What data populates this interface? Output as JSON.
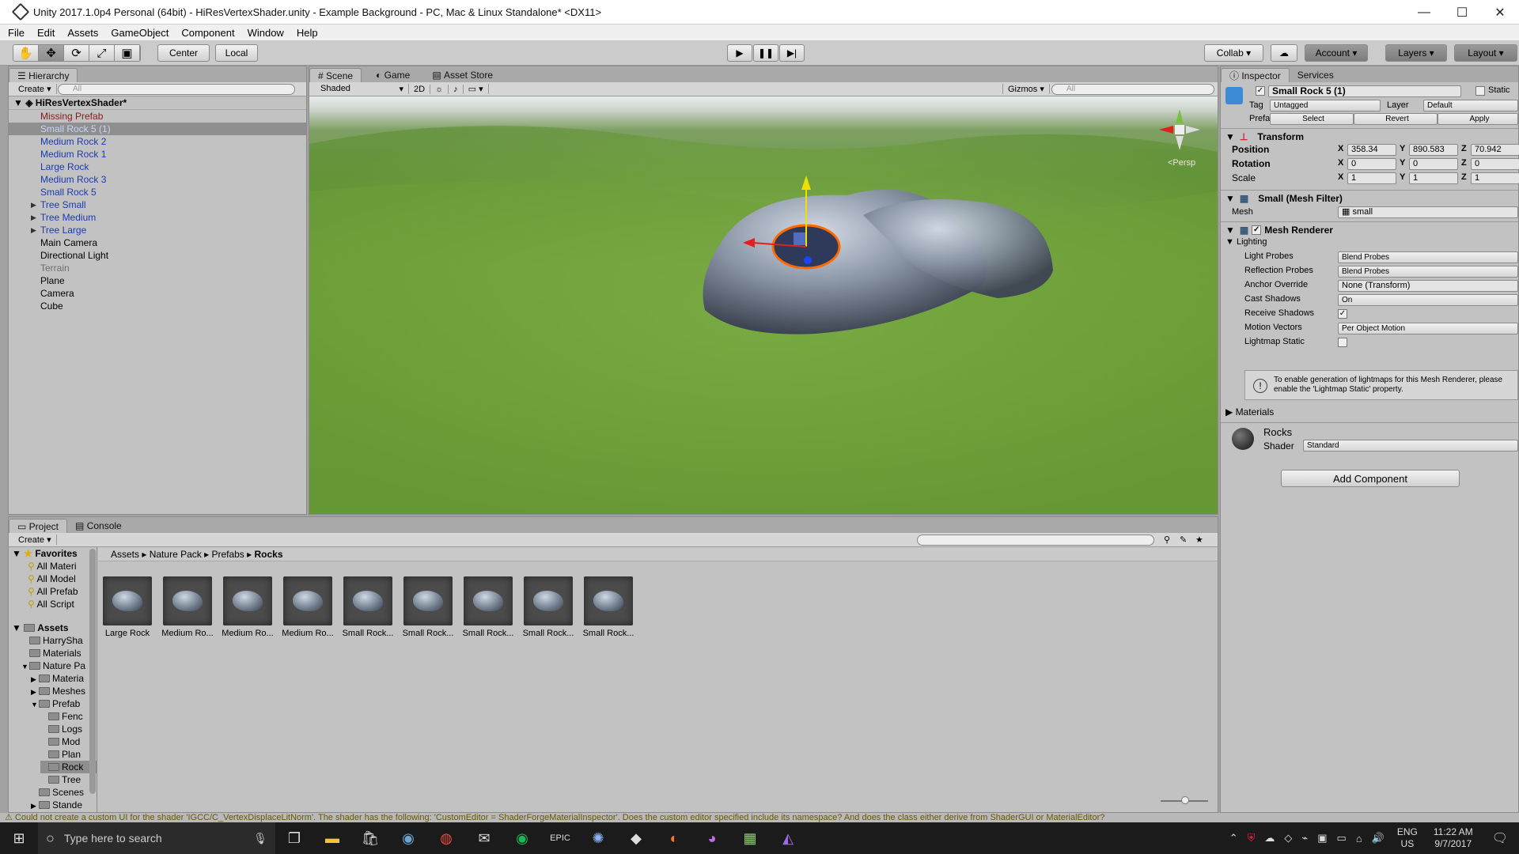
{
  "window": {
    "title": "Unity 2017.1.0p4 Personal (64bit) - HiResVertexShader.unity - Example Background - PC, Mac & Linux Standalone* <DX11>",
    "minimize": "—",
    "maximize": "☐",
    "close": "✕"
  },
  "menu": [
    "File",
    "Edit",
    "Assets",
    "GameObject",
    "Component",
    "Window",
    "Help"
  ],
  "toolbar": {
    "pivot": "Center",
    "space": "Local",
    "collab": "Collab ▾",
    "account": "Account",
    "layers": "Layers",
    "layout": "Layout"
  },
  "hierarchy": {
    "tab": "Hierarchy",
    "create": "Create",
    "search_placeholder": "All",
    "scene_name": "HiResVertexShader*",
    "items": [
      {
        "label": "Missing Prefab",
        "type": "missing",
        "arrow": ""
      },
      {
        "label": "Small Rock 5 (1)",
        "type": "sel",
        "arrow": ""
      },
      {
        "label": "Medium Rock 2",
        "type": "prefab",
        "arrow": ""
      },
      {
        "label": "Medium Rock 1",
        "type": "prefab",
        "arrow": ""
      },
      {
        "label": "Large Rock",
        "type": "prefab",
        "arrow": ""
      },
      {
        "label": "Medium Rock 3",
        "type": "prefab",
        "arrow": ""
      },
      {
        "label": "Small Rock 5",
        "type": "prefab",
        "arrow": ""
      },
      {
        "label": "Tree Small",
        "type": "prefab",
        "arrow": "▶"
      },
      {
        "label": "Tree Medium",
        "type": "prefab",
        "arrow": "▶"
      },
      {
        "label": "Tree Large",
        "type": "prefab",
        "arrow": "▶"
      },
      {
        "label": "Main Camera",
        "type": "normal",
        "arrow": ""
      },
      {
        "label": "Directional Light",
        "type": "normal",
        "arrow": ""
      },
      {
        "label": "Terrain",
        "type": "disabled",
        "arrow": ""
      },
      {
        "label": "Plane",
        "type": "normal",
        "arrow": ""
      },
      {
        "label": "Camera",
        "type": "normal",
        "arrow": ""
      },
      {
        "label": "Cube",
        "type": "normal",
        "arrow": ""
      }
    ]
  },
  "scene": {
    "tabs": [
      "Scene",
      "Game",
      "Asset Store"
    ],
    "shading": "Shaded",
    "mode_2d": "2D",
    "gizmos": "Gizmos",
    "search_placeholder": "All",
    "persp": "<Persp"
  },
  "inspector": {
    "tabs": [
      "Inspector",
      "Services"
    ],
    "object_name": "Small Rock 5 (1)",
    "static": "Static",
    "tag_label": "Tag",
    "tag": "Untagged",
    "layer_label": "Layer",
    "layer": "Default",
    "prefab_label": "Prefab",
    "prefab_buttons": [
      "Select",
      "Revert",
      "Apply"
    ],
    "transform": {
      "title": "Transform",
      "rows": [
        {
          "label": "Position",
          "x": "358.34",
          "y": "890.583",
          "z": "70.942"
        },
        {
          "label": "Rotation",
          "x": "0",
          "y": "0",
          "z": "0"
        },
        {
          "label": "Scale",
          "x": "1",
          "y": "1",
          "z": "1"
        }
      ]
    },
    "mesh_filter": {
      "title": "Small (Mesh Filter)",
      "mesh_label": "Mesh",
      "mesh": "small"
    },
    "mesh_renderer": {
      "title": "Mesh Renderer",
      "lighting": "Lighting",
      "rows": [
        {
          "label": "Light Probes",
          "value": "Blend Probes"
        },
        {
          "label": "Reflection Probes",
          "value": "Blend Probes"
        },
        {
          "label": "Anchor Override",
          "value": "None (Transform)"
        },
        {
          "label": "Cast Shadows",
          "value": "On"
        },
        {
          "label": "Receive Shadows",
          "value": "✓"
        },
        {
          "label": "Motion Vectors",
          "value": "Per Object Motion"
        },
        {
          "label": "Lightmap Static",
          "value": ""
        }
      ],
      "info": "To enable generation of lightmaps for this Mesh Renderer, please enable the 'Lightmap Static' property.",
      "materials": "Materials"
    },
    "material": {
      "name": "Rocks",
      "shader_label": "Shader",
      "shader": "Standard"
    },
    "add_component": "Add Component"
  },
  "project": {
    "tabs": [
      "Project",
      "Console"
    ],
    "create": "Create",
    "favorites_label": "Favorites",
    "favorites": [
      "All Materi",
      "All Model",
      "All Prefab",
      "All Script"
    ],
    "assets_label": "Assets",
    "tree": [
      {
        "label": "HarrySha",
        "indent": 0,
        "arrow": ""
      },
      {
        "label": "Materials",
        "indent": 0,
        "arrow": ""
      },
      {
        "label": "Nature Pa",
        "indent": 0,
        "arrow": "▼"
      },
      {
        "label": "Materia",
        "indent": 1,
        "arrow": "▶"
      },
      {
        "label": "Meshes",
        "indent": 1,
        "arrow": "▶"
      },
      {
        "label": "Prefab",
        "indent": 1,
        "arrow": "▼"
      },
      {
        "label": "Fenc",
        "indent": 2,
        "arrow": ""
      },
      {
        "label": "Logs",
        "indent": 2,
        "arrow": ""
      },
      {
        "label": "Mod",
        "indent": 2,
        "arrow": ""
      },
      {
        "label": "Plan",
        "indent": 2,
        "arrow": ""
      },
      {
        "label": "Rock",
        "indent": 2,
        "arrow": ""
      },
      {
        "label": "Tree",
        "indent": 2,
        "arrow": ""
      },
      {
        "label": "Scenes",
        "indent": 1,
        "arrow": ""
      },
      {
        "label": "Stande",
        "indent": 1,
        "arrow": "▶"
      }
    ],
    "breadcrumb": [
      "Assets",
      "Nature Pack",
      "Prefabs",
      "Rocks"
    ],
    "assets": [
      "Large Rock",
      "Medium Ro...",
      "Medium Ro...",
      "Medium Ro...",
      "Small Rock...",
      "Small Rock...",
      "Small Rock...",
      "Small Rock...",
      "Small Rock..."
    ]
  },
  "status": "Could not create a custom UI for the shader 'IGCC/C_VertexDisplaceLitNorm'. The shader has the following: 'CustomEditor = ShaderForgeMaterialInspector'. Does the custom editor specified include its namespace? And does the class either derive from ShaderGUI or MaterialEditor?",
  "taskbar": {
    "search_placeholder": "Type here to search",
    "lang": "ENG",
    "region": "US",
    "time": "11:22 AM",
    "date": "9/7/2017"
  }
}
